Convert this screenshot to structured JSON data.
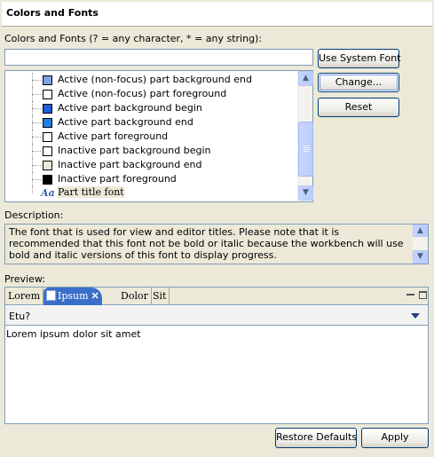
{
  "header": {
    "title": "Colors and Fonts"
  },
  "filter": {
    "label": "Colors and Fonts (? = any character, * = any string):",
    "value": ""
  },
  "buttons": {
    "use_system_font": "Use System Font",
    "change": "Change...",
    "reset": "Reset",
    "restore_defaults": "Restore Defaults",
    "apply": "Apply"
  },
  "tree": {
    "items": [
      {
        "label": "Active (non-focus) part background end",
        "color": "#7ea1e6"
      },
      {
        "label": "Active (non-focus) part foreground",
        "color": "#ffffff"
      },
      {
        "label": "Active part background begin",
        "color": "#1f5ed6"
      },
      {
        "label": "Active part background end",
        "color": "#1f7ee6"
      },
      {
        "label": "Active part foreground",
        "color": "#ffffff"
      },
      {
        "label": "Inactive part background begin",
        "color": "#ffffff"
      },
      {
        "label": "Inactive part background end",
        "color": "#ece9d8"
      },
      {
        "label": "Inactive part foreground",
        "color": "#000000"
      }
    ],
    "font_item": {
      "icon_text": "Aa",
      "label": "Part title font"
    }
  },
  "description": {
    "label": "Description:",
    "text": "The font that is used for view and editor titles.  Please note that it is recommended that this font not be bold or italic because the workbench will use bold and italic versions of this font to display progress."
  },
  "preview": {
    "label": "Preview:",
    "tabs": [
      "Lorem",
      "Ipsum",
      "Dolor",
      "Sit"
    ],
    "combo_value": "Etu?",
    "content": "Lorem ipsum dolor sit amet"
  }
}
